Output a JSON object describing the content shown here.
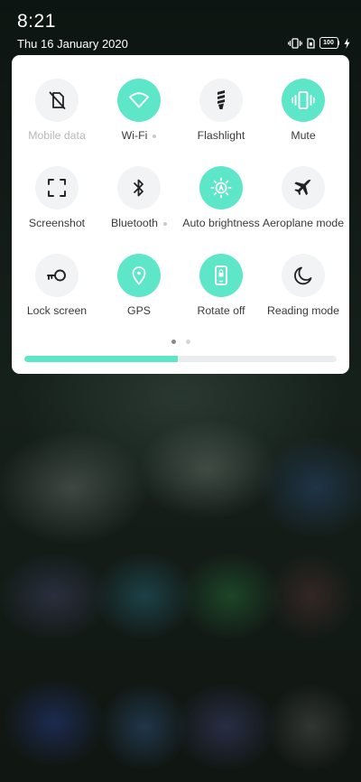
{
  "status_bar": {
    "time": "8:21",
    "date": "Thu 16 January 2020",
    "battery_level": "100",
    "icons": [
      "vibrate-icon",
      "sim-icon",
      "battery-icon",
      "charging-icon"
    ]
  },
  "colors": {
    "accent": "#5ee6c9",
    "tile_off": "#f2f3f4",
    "panel": "#ffffff"
  },
  "quick_settings": {
    "tiles": [
      {
        "label": "Mobile data",
        "icon": "mobile-data-off-icon",
        "state": "disabled"
      },
      {
        "label": "Wi-Fi",
        "icon": "wifi-icon",
        "state": "on",
        "has_more": true
      },
      {
        "label": "Flashlight",
        "icon": "flashlight-icon",
        "state": "off"
      },
      {
        "label": "Mute",
        "icon": "vibrate-icon",
        "state": "on"
      },
      {
        "label": "Screenshot",
        "icon": "screenshot-icon",
        "state": "off"
      },
      {
        "label": "Bluetooth",
        "icon": "bluetooth-icon",
        "state": "off",
        "has_more": true
      },
      {
        "label": "Auto brightness",
        "icon": "brightness-icon",
        "state": "on"
      },
      {
        "label": "Aeroplane mode",
        "icon": "airplane-icon",
        "state": "off"
      },
      {
        "label": "Lock screen",
        "icon": "key-icon",
        "state": "off"
      },
      {
        "label": "GPS",
        "icon": "location-pin-icon",
        "state": "on"
      },
      {
        "label": "Rotate off",
        "icon": "rotate-lock-icon",
        "state": "on"
      },
      {
        "label": "Reading mode",
        "icon": "moon-icon",
        "state": "off"
      }
    ],
    "page_count": 2,
    "current_page": 1
  },
  "brightness": {
    "level": 0.49
  }
}
